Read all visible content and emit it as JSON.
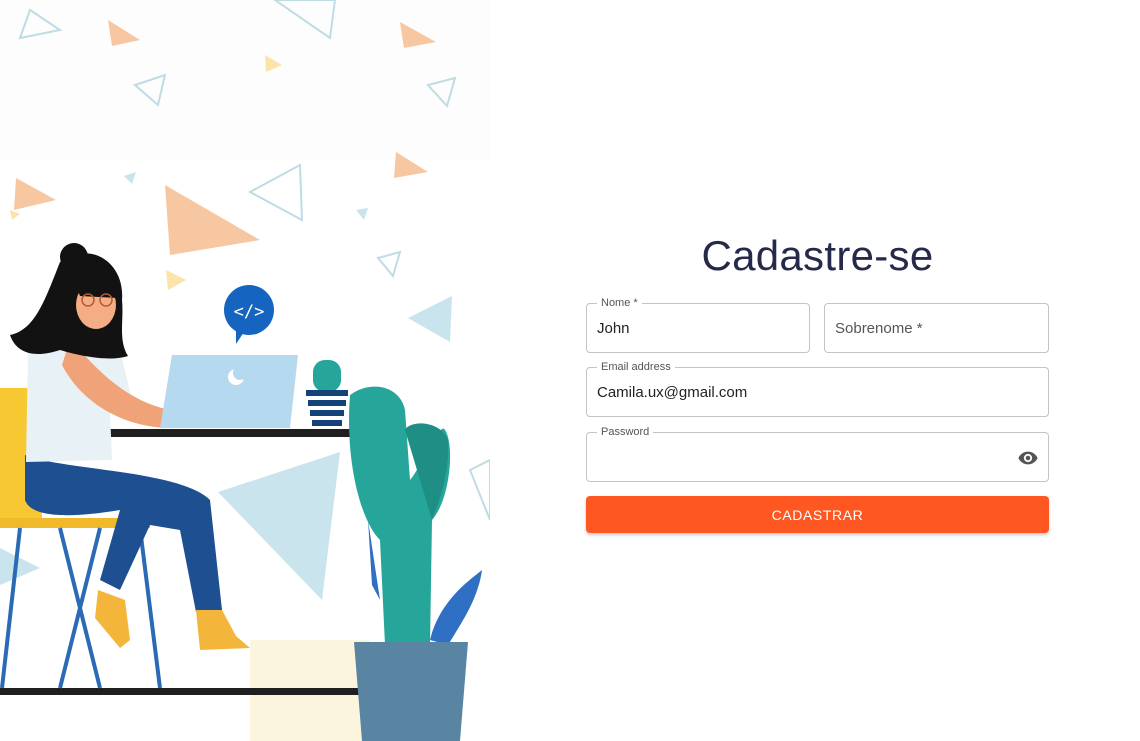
{
  "form": {
    "title": "Cadastre-se",
    "first_name": {
      "label": "Nome *",
      "value": "John"
    },
    "last_name": {
      "placeholder": "Sobrenome *",
      "value": ""
    },
    "email": {
      "label": "Email address",
      "value": "Camila.ux@gmail.com"
    },
    "password": {
      "label": "Password",
      "value": "",
      "toggle_icon": "eye-icon"
    },
    "submit_label": "CADASTRAR"
  },
  "illustration": {
    "speech_bubble_text": "</>",
    "description_icon": "woman-working-on-laptop"
  },
  "colors": {
    "accent": "#ff5722",
    "title": "#262a4a",
    "border": "#c4c4c4"
  }
}
